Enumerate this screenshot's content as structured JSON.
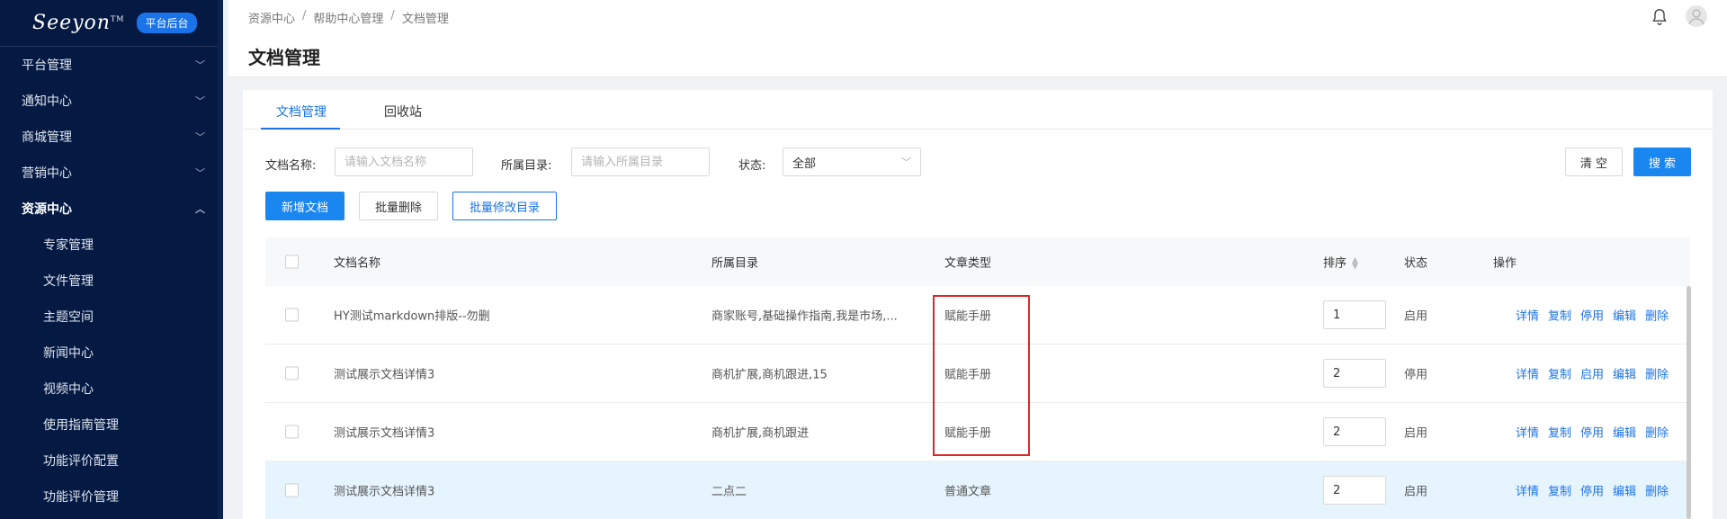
{
  "sidebar": {
    "logo": "Seeyon",
    "logo_tm": "TM",
    "badge": "平台后台",
    "menu": [
      {
        "label": "平台管理",
        "state": "collapsed"
      },
      {
        "label": "通知中心",
        "state": "collapsed"
      },
      {
        "label": "商城管理",
        "state": "collapsed"
      },
      {
        "label": "营销中心",
        "state": "collapsed"
      },
      {
        "label": "资源中心",
        "state": "expanded"
      }
    ],
    "submenu": [
      "专家管理",
      "文件管理",
      "主题空间",
      "新闻中心",
      "视频中心",
      "使用指南管理",
      "功能评价配置",
      "功能评价管理"
    ]
  },
  "header": {
    "breadcrumb": [
      "资源中心",
      "帮助中心管理",
      "文档管理"
    ],
    "title": "文档管理"
  },
  "tabs": [
    "文档管理",
    "回收站"
  ],
  "filters": {
    "name_label": "文档名称:",
    "name_placeholder": "请输入文档名称",
    "dir_label": "所属目录:",
    "dir_placeholder": "请输入所属目录",
    "status_label": "状态:",
    "status_value": "全部"
  },
  "buttons": {
    "clear": "清 空",
    "search": "搜 索",
    "add": "新增文档",
    "batch_delete": "批量删除",
    "batch_edit_dir": "批量修改目录"
  },
  "table": {
    "columns": [
      "文档名称",
      "所属目录",
      "文章类型",
      "排序",
      "状态",
      "操作"
    ],
    "rows": [
      {
        "name": "HY测试markdown排版--勿删",
        "dir": "商家账号,基础操作指南,我是市场,...",
        "type": "赋能手册",
        "order": "1",
        "status": "启用",
        "ops": [
          "详情",
          "复制",
          "停用",
          "编辑",
          "删除"
        ]
      },
      {
        "name": "测试展示文档详情3",
        "dir": "商机扩展,商机跟进,15",
        "type": "赋能手册",
        "order": "2",
        "status": "停用",
        "ops": [
          "详情",
          "复制",
          "启用",
          "编辑",
          "删除"
        ]
      },
      {
        "name": "测试展示文档详情3",
        "dir": "商机扩展,商机跟进",
        "type": "赋能手册",
        "order": "2",
        "status": "启用",
        "ops": [
          "详情",
          "复制",
          "停用",
          "编辑",
          "删除"
        ]
      },
      {
        "name": "测试展示文档详情3",
        "dir": "二点二",
        "type": "普通文章",
        "order": "2",
        "status": "启用",
        "ops": [
          "详情",
          "复制",
          "停用",
          "编辑",
          "删除"
        ]
      }
    ]
  },
  "colors": {
    "sidebar_bg": "#051a43",
    "primary": "#1a86f0",
    "highlight_box": "#e0262a",
    "row_highlight": "#e6f4fd"
  }
}
